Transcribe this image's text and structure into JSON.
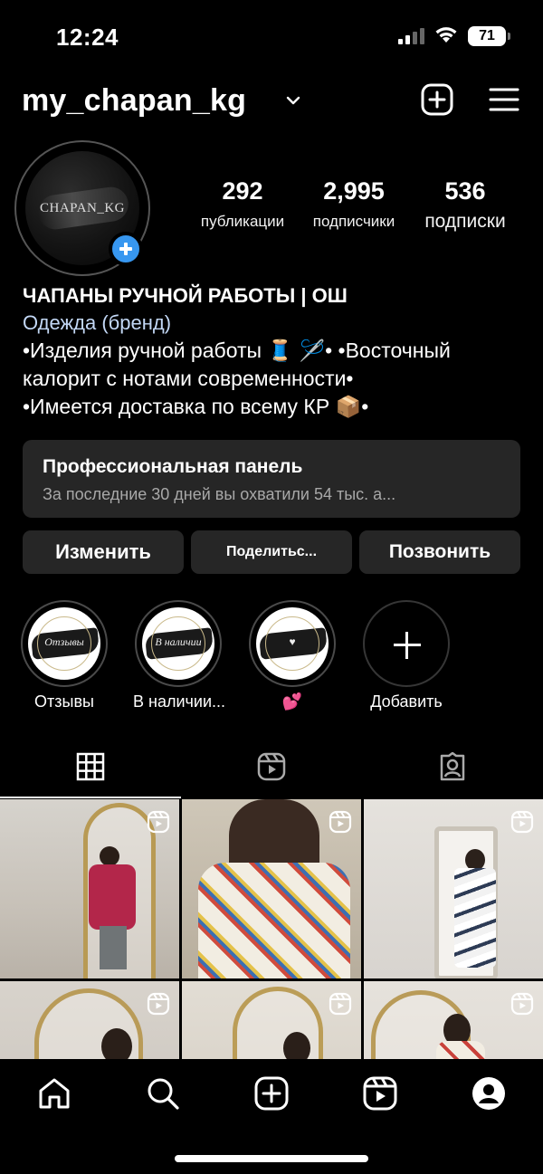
{
  "status_bar": {
    "time": "12:24",
    "battery": "71"
  },
  "header": {
    "username": "my_chapan_kg"
  },
  "avatar": {
    "label": "CHAPAN_KG"
  },
  "stats": [
    {
      "value": "292",
      "label": "публикации"
    },
    {
      "value": "2,995",
      "label": "подписчики"
    },
    {
      "value": "536",
      "label": "подписки"
    }
  ],
  "bio": {
    "name": "ЧАПАНЫ РУЧНОЙ РАБОТЫ | ОШ",
    "category": "Одежда (бренд)",
    "lines": [
      "•Изделия ручной работы 🧵 🪡• •Восточный",
      "калорит с нотами современности•",
      "•Имеется доставка по всему КР 📦•"
    ]
  },
  "pro_panel": {
    "title": "Профессиональная панель",
    "subtitle": "За последние 30 дней вы охватили 54 тыс. а..."
  },
  "actions": {
    "edit": "Изменить",
    "share": "Поделитьс...",
    "call": "Позвонить"
  },
  "highlights": [
    {
      "label": "Отзывы",
      "cover_text": "Отзывы"
    },
    {
      "label": "В наличии...",
      "cover_text": "В наличии"
    },
    {
      "label": "💕",
      "cover_text": "♥"
    },
    {
      "label": "Добавить"
    }
  ],
  "tabs": [
    "grid-icon",
    "reels-icon",
    "tagged-icon"
  ],
  "colors": {
    "accent": "#3797f0",
    "panel": "#262626",
    "category_link": "#c3d8f6"
  }
}
